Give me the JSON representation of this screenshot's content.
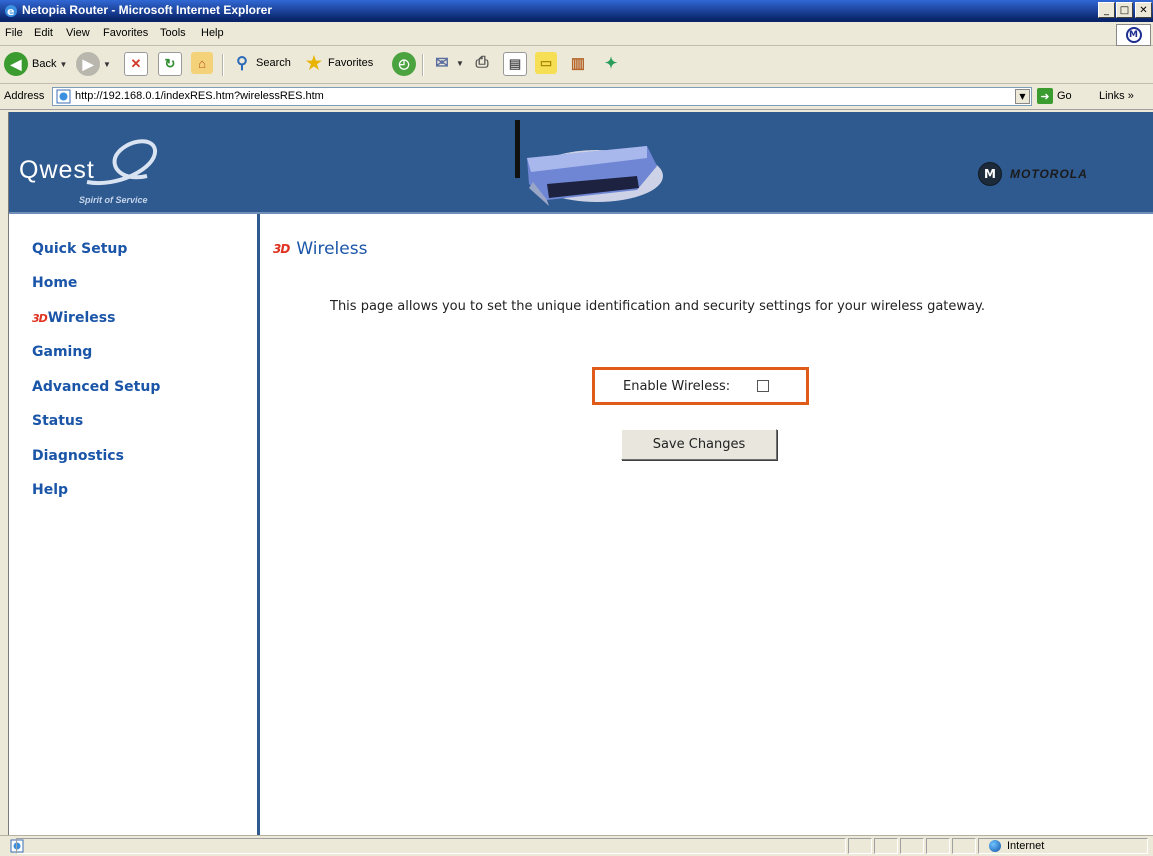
{
  "window": {
    "title": "Netopia Router - Microsoft Internet Explorer"
  },
  "menu": [
    "File",
    "Edit",
    "View",
    "Favorites",
    "Tools",
    "Help"
  ],
  "toolbar": {
    "back_label": "Back",
    "search_label": "Search",
    "favorites_label": "Favorites"
  },
  "address": {
    "label": "Address",
    "url": "http://192.168.0.1/indexRES.htm?wirelessRES.htm",
    "go_label": "Go",
    "links_label": "Links"
  },
  "banner": {
    "brand": "Qwest",
    "tagline": "Spirit of Service",
    "partner": "MOTOROLA"
  },
  "sidebar": {
    "items": [
      {
        "label": "Quick Setup"
      },
      {
        "label": "Home"
      },
      {
        "label": "Wireless",
        "icon": "3d"
      },
      {
        "label": "Gaming"
      },
      {
        "label": "Advanced Setup"
      },
      {
        "label": "Status"
      },
      {
        "label": "Diagnostics"
      },
      {
        "label": "Help"
      }
    ]
  },
  "main": {
    "heading": "Wireless",
    "description": "This page allows you to set the unique identification and security settings for your wireless gateway.",
    "enable_label": "Enable Wireless:",
    "enable_checked": false,
    "save_label": "Save Changes"
  },
  "status": {
    "zone": "Internet"
  },
  "colors": {
    "banner": "#2f5a8f",
    "link": "#1a55a8",
    "highlight": "#e05a1a"
  }
}
